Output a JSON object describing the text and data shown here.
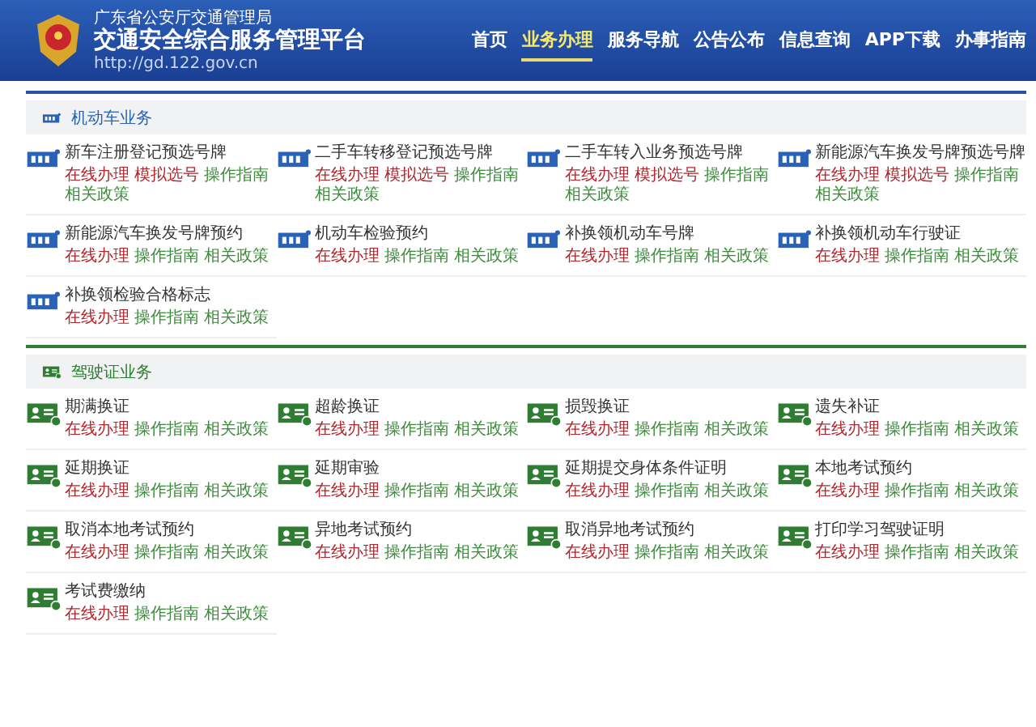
{
  "header": {
    "agency": "广东省公安厅交通管理局",
    "title": "交通安全综合服务管理平台",
    "url": "http://gd.122.gov.cn"
  },
  "nav": [
    {
      "label": "首页",
      "selected": false
    },
    {
      "label": "业务办理",
      "selected": true
    },
    {
      "label": "服务导航",
      "selected": false
    },
    {
      "label": "公告公布",
      "selected": false
    },
    {
      "label": "信息查询",
      "selected": false
    },
    {
      "label": "APP下载",
      "selected": false
    },
    {
      "label": "办事指南",
      "selected": false
    }
  ],
  "sections": [
    {
      "kind": "vehicle",
      "title": "机动车业务",
      "items": [
        {
          "title": "新车注册登记预选号牌",
          "links": [
            {
              "label": "在线办理",
              "color": "#b0272d"
            },
            {
              "label": "模拟选号",
              "color": "#b0272d"
            },
            {
              "label": "操作指南",
              "color": "#3d8a3d"
            },
            {
              "label": "相关政策",
              "color": "#3d8a3d"
            }
          ]
        },
        {
          "title": "二手车转移登记预选号牌",
          "links": [
            {
              "label": "在线办理",
              "color": "#b0272d"
            },
            {
              "label": "模拟选号",
              "color": "#b0272d"
            },
            {
              "label": "操作指南",
              "color": "#3d8a3d"
            },
            {
              "label": "相关政策",
              "color": "#3d8a3d"
            }
          ]
        },
        {
          "title": "二手车转入业务预选号牌",
          "links": [
            {
              "label": "在线办理",
              "color": "#b0272d"
            },
            {
              "label": "模拟选号",
              "color": "#b0272d"
            },
            {
              "label": "操作指南",
              "color": "#3d8a3d"
            },
            {
              "label": "相关政策",
              "color": "#3d8a3d"
            }
          ]
        },
        {
          "title": "新能源汽车换发号牌预选号牌",
          "links": [
            {
              "label": "在线办理",
              "color": "#b0272d"
            },
            {
              "label": "模拟选号",
              "color": "#b0272d"
            },
            {
              "label": "操作指南",
              "color": "#3d8a3d"
            },
            {
              "label": "相关政策",
              "color": "#3d8a3d"
            }
          ]
        },
        {
          "title": "新能源汽车换发号牌预约",
          "links": [
            {
              "label": "在线办理",
              "color": "#b0272d"
            },
            {
              "label": "操作指南",
              "color": "#3d8a3d"
            },
            {
              "label": "相关政策",
              "color": "#3d8a3d"
            }
          ]
        },
        {
          "title": "机动车检验预约",
          "links": [
            {
              "label": "在线办理",
              "color": "#b0272d"
            },
            {
              "label": "操作指南",
              "color": "#3d8a3d"
            },
            {
              "label": "相关政策",
              "color": "#3d8a3d"
            }
          ]
        },
        {
          "title": "补换领机动车号牌",
          "links": [
            {
              "label": "在线办理",
              "color": "#b0272d"
            },
            {
              "label": "操作指南",
              "color": "#3d8a3d"
            },
            {
              "label": "相关政策",
              "color": "#3d8a3d"
            }
          ]
        },
        {
          "title": "补换领机动车行驶证",
          "links": [
            {
              "label": "在线办理",
              "color": "#b0272d"
            },
            {
              "label": "操作指南",
              "color": "#3d8a3d"
            },
            {
              "label": "相关政策",
              "color": "#3d8a3d"
            }
          ]
        },
        {
          "title": "补换领检验合格标志",
          "links": [
            {
              "label": "在线办理",
              "color": "#b0272d"
            },
            {
              "label": "操作指南",
              "color": "#3d8a3d"
            },
            {
              "label": "相关政策",
              "color": "#3d8a3d"
            }
          ]
        }
      ]
    },
    {
      "kind": "license",
      "title": "驾驶证业务",
      "items": [
        {
          "title": "期满换证",
          "links": [
            {
              "label": "在线办理",
              "color": "#b0272d"
            },
            {
              "label": "操作指南",
              "color": "#3d8a3d"
            },
            {
              "label": "相关政策",
              "color": "#3d8a3d"
            }
          ]
        },
        {
          "title": "超龄换证",
          "links": [
            {
              "label": "在线办理",
              "color": "#b0272d"
            },
            {
              "label": "操作指南",
              "color": "#3d8a3d"
            },
            {
              "label": "相关政策",
              "color": "#3d8a3d"
            }
          ]
        },
        {
          "title": "损毁换证",
          "links": [
            {
              "label": "在线办理",
              "color": "#b0272d"
            },
            {
              "label": "操作指南",
              "color": "#3d8a3d"
            },
            {
              "label": "相关政策",
              "color": "#3d8a3d"
            }
          ]
        },
        {
          "title": "遗失补证",
          "links": [
            {
              "label": "在线办理",
              "color": "#b0272d"
            },
            {
              "label": "操作指南",
              "color": "#3d8a3d"
            },
            {
              "label": "相关政策",
              "color": "#3d8a3d"
            }
          ]
        },
        {
          "title": "延期换证",
          "links": [
            {
              "label": "在线办理",
              "color": "#b0272d"
            },
            {
              "label": "操作指南",
              "color": "#3d8a3d"
            },
            {
              "label": "相关政策",
              "color": "#3d8a3d"
            }
          ]
        },
        {
          "title": "延期审验",
          "links": [
            {
              "label": "在线办理",
              "color": "#b0272d"
            },
            {
              "label": "操作指南",
              "color": "#3d8a3d"
            },
            {
              "label": "相关政策",
              "color": "#3d8a3d"
            }
          ]
        },
        {
          "title": "延期提交身体条件证明",
          "links": [
            {
              "label": "在线办理",
              "color": "#b0272d"
            },
            {
              "label": "操作指南",
              "color": "#3d8a3d"
            },
            {
              "label": "相关政策",
              "color": "#3d8a3d"
            }
          ]
        },
        {
          "title": "本地考试预约",
          "links": [
            {
              "label": "在线办理",
              "color": "#b0272d"
            },
            {
              "label": "操作指南",
              "color": "#3d8a3d"
            },
            {
              "label": "相关政策",
              "color": "#3d8a3d"
            }
          ]
        },
        {
          "title": "取消本地考试预约",
          "links": [
            {
              "label": "在线办理",
              "color": "#b0272d"
            },
            {
              "label": "操作指南",
              "color": "#3d8a3d"
            },
            {
              "label": "相关政策",
              "color": "#3d8a3d"
            }
          ]
        },
        {
          "title": "异地考试预约",
          "links": [
            {
              "label": "在线办理",
              "color": "#b0272d"
            },
            {
              "label": "操作指南",
              "color": "#3d8a3d"
            },
            {
              "label": "相关政策",
              "color": "#3d8a3d"
            }
          ]
        },
        {
          "title": "取消异地考试预约",
          "links": [
            {
              "label": "在线办理",
              "color": "#b0272d"
            },
            {
              "label": "操作指南",
              "color": "#3d8a3d"
            },
            {
              "label": "相关政策",
              "color": "#3d8a3d"
            }
          ]
        },
        {
          "title": "打印学习驾驶证明",
          "links": [
            {
              "label": "在线办理",
              "color": "#b0272d"
            },
            {
              "label": "操作指南",
              "color": "#3d8a3d"
            },
            {
              "label": "相关政策",
              "color": "#3d8a3d"
            }
          ]
        },
        {
          "title": "考试费缴纳",
          "links": [
            {
              "label": "在线办理",
              "color": "#b0272d"
            },
            {
              "label": "操作指南",
              "color": "#3d8a3d"
            },
            {
              "label": "相关政策",
              "color": "#3d8a3d"
            }
          ]
        }
      ]
    }
  ]
}
